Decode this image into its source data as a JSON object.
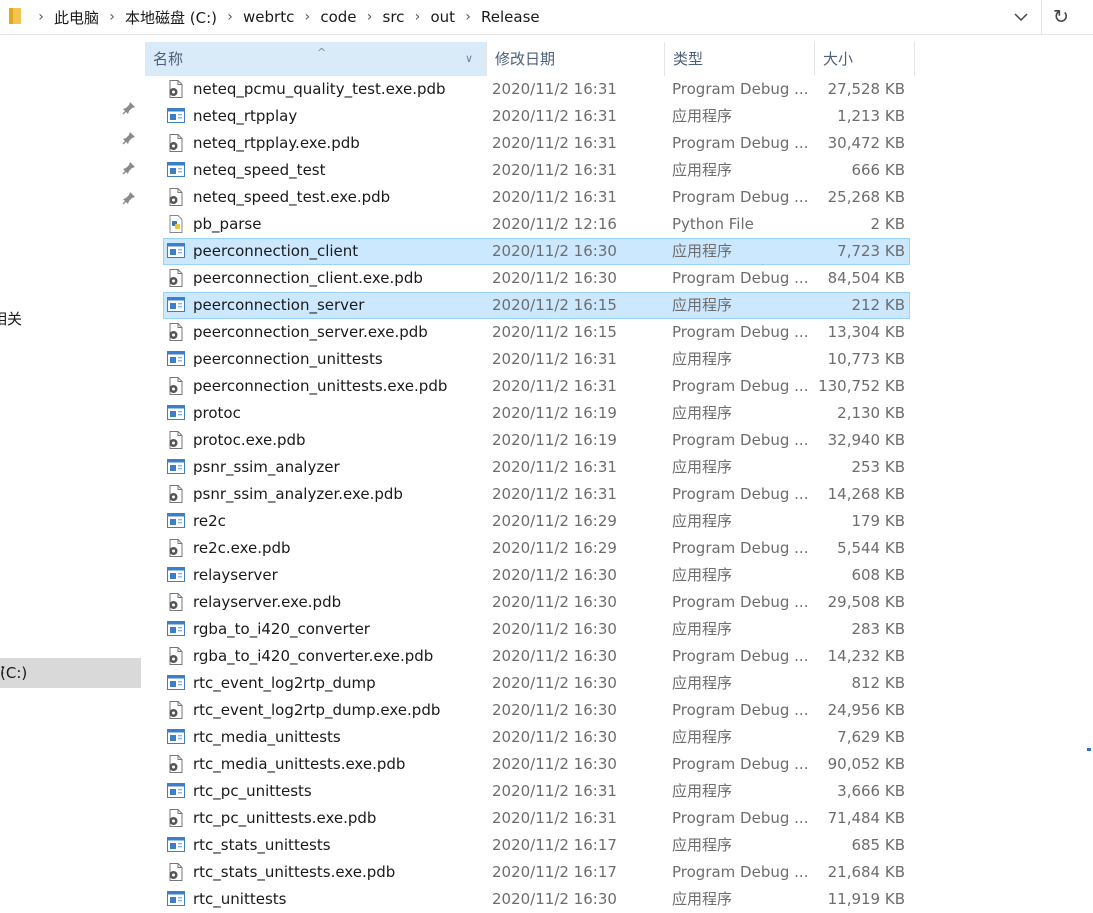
{
  "address": {
    "crumbs": [
      "此电脑",
      "本地磁盘 (C:)",
      "webrtc",
      "code",
      "src",
      "out",
      "Release"
    ]
  },
  "nav": {
    "partial_label_1": "相关",
    "selected_drive": "(C:)",
    "partial_label_2": "):"
  },
  "columns": {
    "name": "名称",
    "date": "修改日期",
    "type": "类型",
    "size": "大小"
  },
  "files": [
    {
      "name": "neteq_pcmu_quality_test.exe.pdb",
      "date": "2020/11/2 16:31",
      "type": "Program Debug ...",
      "size": "27,528 KB",
      "icon": "pdb-icon",
      "selected": false
    },
    {
      "name": "neteq_rtpplay",
      "date": "2020/11/2 16:31",
      "type": "应用程序",
      "size": "1,213 KB",
      "icon": "exe-icon",
      "selected": false
    },
    {
      "name": "neteq_rtpplay.exe.pdb",
      "date": "2020/11/2 16:31",
      "type": "Program Debug ...",
      "size": "30,472 KB",
      "icon": "pdb-icon",
      "selected": false
    },
    {
      "name": "neteq_speed_test",
      "date": "2020/11/2 16:31",
      "type": "应用程序",
      "size": "666 KB",
      "icon": "exe-icon",
      "selected": false
    },
    {
      "name": "neteq_speed_test.exe.pdb",
      "date": "2020/11/2 16:31",
      "type": "Program Debug ...",
      "size": "25,268 KB",
      "icon": "pdb-icon",
      "selected": false
    },
    {
      "name": "pb_parse",
      "date": "2020/11/2 12:16",
      "type": "Python File",
      "size": "2 KB",
      "icon": "python-icon",
      "selected": false
    },
    {
      "name": "peerconnection_client",
      "date": "2020/11/2 16:30",
      "type": "应用程序",
      "size": "7,723 KB",
      "icon": "exe-icon",
      "selected": true
    },
    {
      "name": "peerconnection_client.exe.pdb",
      "date": "2020/11/2 16:30",
      "type": "Program Debug ...",
      "size": "84,504 KB",
      "icon": "pdb-icon",
      "selected": false
    },
    {
      "name": "peerconnection_server",
      "date": "2020/11/2 16:15",
      "type": "应用程序",
      "size": "212 KB",
      "icon": "exe-icon",
      "selected": true
    },
    {
      "name": "peerconnection_server.exe.pdb",
      "date": "2020/11/2 16:15",
      "type": "Program Debug ...",
      "size": "13,304 KB",
      "icon": "pdb-icon",
      "selected": false
    },
    {
      "name": "peerconnection_unittests",
      "date": "2020/11/2 16:31",
      "type": "应用程序",
      "size": "10,773 KB",
      "icon": "exe-icon",
      "selected": false
    },
    {
      "name": "peerconnection_unittests.exe.pdb",
      "date": "2020/11/2 16:31",
      "type": "Program Debug ...",
      "size": "130,752 KB",
      "icon": "pdb-icon",
      "selected": false
    },
    {
      "name": "protoc",
      "date": "2020/11/2 16:19",
      "type": "应用程序",
      "size": "2,130 KB",
      "icon": "exe-icon",
      "selected": false
    },
    {
      "name": "protoc.exe.pdb",
      "date": "2020/11/2 16:19",
      "type": "Program Debug ...",
      "size": "32,940 KB",
      "icon": "pdb-icon",
      "selected": false
    },
    {
      "name": "psnr_ssim_analyzer",
      "date": "2020/11/2 16:31",
      "type": "应用程序",
      "size": "253 KB",
      "icon": "exe-icon",
      "selected": false
    },
    {
      "name": "psnr_ssim_analyzer.exe.pdb",
      "date": "2020/11/2 16:31",
      "type": "Program Debug ...",
      "size": "14,268 KB",
      "icon": "pdb-icon",
      "selected": false
    },
    {
      "name": "re2c",
      "date": "2020/11/2 16:29",
      "type": "应用程序",
      "size": "179 KB",
      "icon": "exe-icon",
      "selected": false
    },
    {
      "name": "re2c.exe.pdb",
      "date": "2020/11/2 16:29",
      "type": "Program Debug ...",
      "size": "5,544 KB",
      "icon": "pdb-icon",
      "selected": false
    },
    {
      "name": "relayserver",
      "date": "2020/11/2 16:30",
      "type": "应用程序",
      "size": "608 KB",
      "icon": "exe-icon",
      "selected": false
    },
    {
      "name": "relayserver.exe.pdb",
      "date": "2020/11/2 16:30",
      "type": "Program Debug ...",
      "size": "29,508 KB",
      "icon": "pdb-icon",
      "selected": false
    },
    {
      "name": "rgba_to_i420_converter",
      "date": "2020/11/2 16:30",
      "type": "应用程序",
      "size": "283 KB",
      "icon": "exe-icon",
      "selected": false
    },
    {
      "name": "rgba_to_i420_converter.exe.pdb",
      "date": "2020/11/2 16:30",
      "type": "Program Debug ...",
      "size": "14,232 KB",
      "icon": "pdb-icon",
      "selected": false
    },
    {
      "name": "rtc_event_log2rtp_dump",
      "date": "2020/11/2 16:30",
      "type": "应用程序",
      "size": "812 KB",
      "icon": "exe-icon",
      "selected": false
    },
    {
      "name": "rtc_event_log2rtp_dump.exe.pdb",
      "date": "2020/11/2 16:30",
      "type": "Program Debug ...",
      "size": "24,956 KB",
      "icon": "pdb-icon",
      "selected": false
    },
    {
      "name": "rtc_media_unittests",
      "date": "2020/11/2 16:30",
      "type": "应用程序",
      "size": "7,629 KB",
      "icon": "exe-icon",
      "selected": false
    },
    {
      "name": "rtc_media_unittests.exe.pdb",
      "date": "2020/11/2 16:30",
      "type": "Program Debug ...",
      "size": "90,052 KB",
      "icon": "pdb-icon",
      "selected": false
    },
    {
      "name": "rtc_pc_unittests",
      "date": "2020/11/2 16:31",
      "type": "应用程序",
      "size": "3,666 KB",
      "icon": "exe-icon",
      "selected": false
    },
    {
      "name": "rtc_pc_unittests.exe.pdb",
      "date": "2020/11/2 16:31",
      "type": "Program Debug ...",
      "size": "71,484 KB",
      "icon": "pdb-icon",
      "selected": false
    },
    {
      "name": "rtc_stats_unittests",
      "date": "2020/11/2 16:17",
      "type": "应用程序",
      "size": "685 KB",
      "icon": "exe-icon",
      "selected": false
    },
    {
      "name": "rtc_stats_unittests.exe.pdb",
      "date": "2020/11/2 16:17",
      "type": "Program Debug ...",
      "size": "21,684 KB",
      "icon": "pdb-icon",
      "selected": false
    },
    {
      "name": "rtc_unittests",
      "date": "2020/11/2 16:30",
      "type": "应用程序",
      "size": "11,919 KB",
      "icon": "exe-icon",
      "selected": false
    }
  ],
  "colors": {
    "selection_bg": "#cce8ff",
    "selection_border": "#99d1ff",
    "header_sorted_bg": "#d9ebf9",
    "header_text": "#4c607a",
    "secondary_text": "#6d6d6d",
    "nav_selected_bg": "#d9d9d9"
  }
}
